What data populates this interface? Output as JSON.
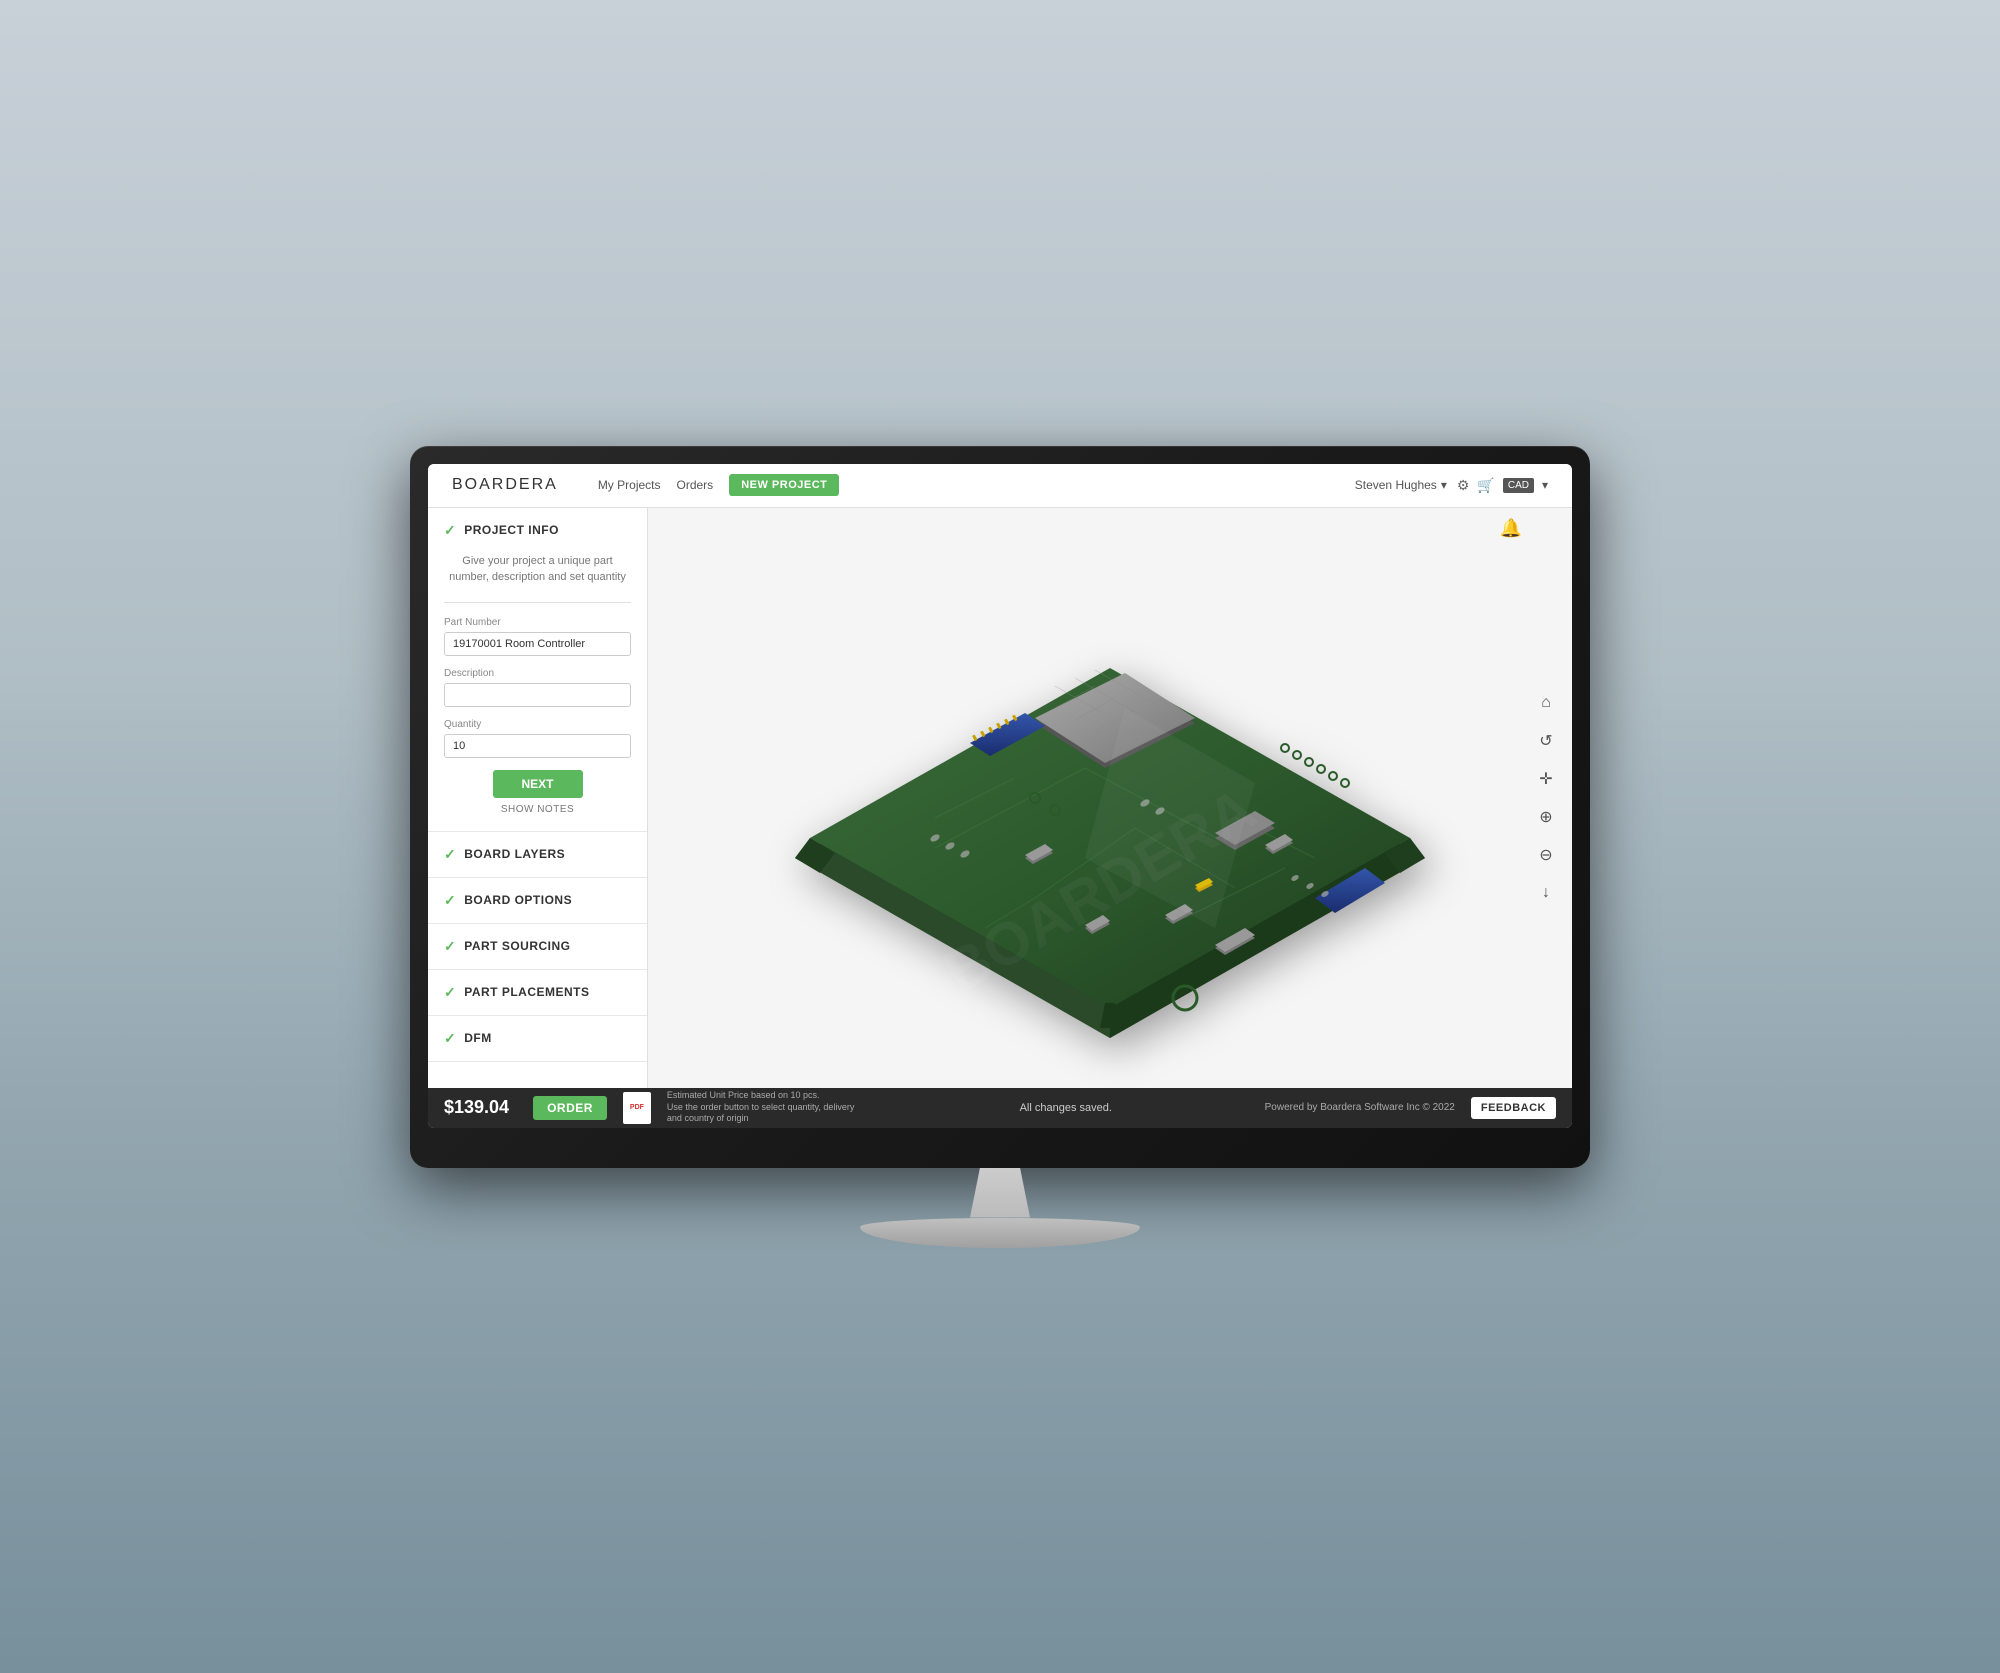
{
  "brand": {
    "name_part1": "BOARD",
    "name_part2": "ERA"
  },
  "navbar": {
    "my_projects": "My Projects",
    "orders": "Orders",
    "new_project": "NEW PROJECT",
    "user_name": "Steven Hughes",
    "currency": "CAD"
  },
  "sidebar": {
    "sections": [
      {
        "id": "project-info",
        "label": "PROJECT INFO",
        "active": true,
        "description": "Give your project a unique part number, description and set quantity"
      },
      {
        "id": "board-layers",
        "label": "BOARD LAYERS",
        "active": false
      },
      {
        "id": "board-options",
        "label": "BOARD OPTIONS",
        "active": false
      },
      {
        "id": "part-sourcing",
        "label": "PART SOURCING",
        "active": false
      },
      {
        "id": "part-placements",
        "label": "PART PLACEMENTS",
        "active": false
      },
      {
        "id": "dfm",
        "label": "DFM",
        "active": false
      }
    ],
    "form": {
      "part_number_label": "Part Number",
      "part_number_value": "19170001 Room Controller",
      "description_label": "Description",
      "description_value": "",
      "quantity_label": "Quantity",
      "quantity_value": "10",
      "next_button": "NEXT",
      "show_notes": "SHOW NOTES"
    }
  },
  "viewer": {
    "toolbar": {
      "home": "⌂",
      "refresh": "↺",
      "move": "✛",
      "zoom_in": "🔍+",
      "zoom_out": "🔍-",
      "download": "↓"
    }
  },
  "bottom_bar": {
    "price": "$139.04",
    "order_btn": "ORDER",
    "estimated_label": "Estimated Unit Price based on 10 pcs.",
    "estimated_sub": "Use the order button to select quantity, delivery and country of origin",
    "status": "All changes saved.",
    "powered": "Powered by Boardera Software Inc © 2022",
    "feedback_btn": "FEEDBACK"
  }
}
